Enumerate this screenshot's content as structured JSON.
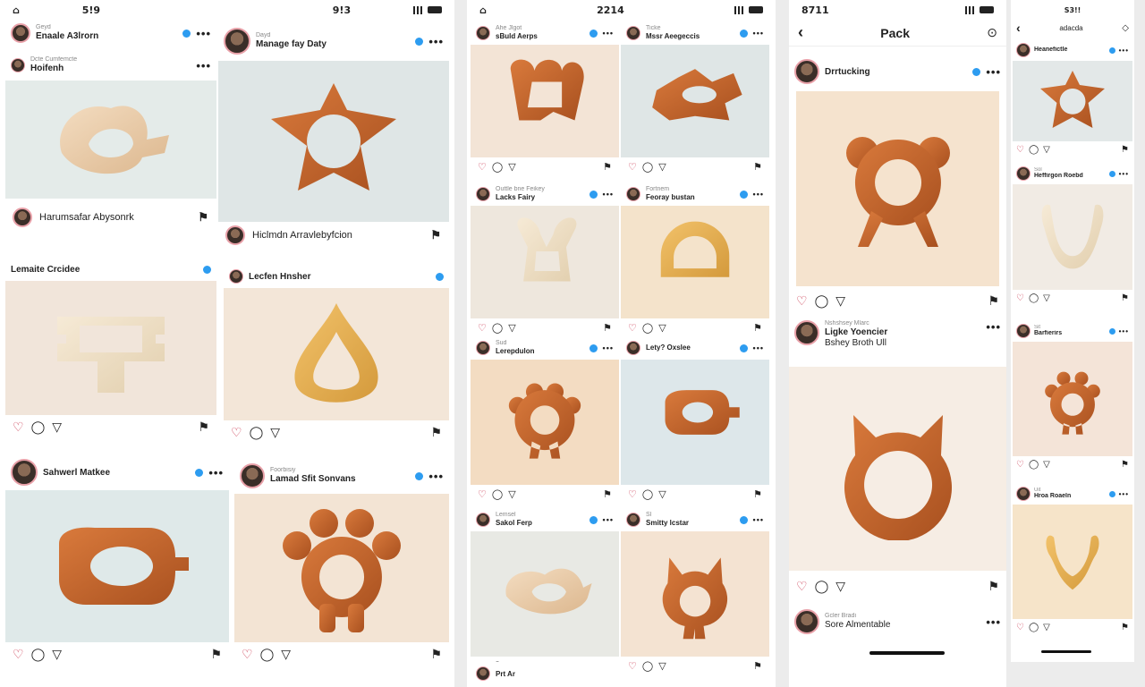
{
  "phone1": {
    "status": {
      "time_left": "5!9",
      "time_right": "9!3"
    },
    "posts": [
      {
        "user": "Enaale A3lrorn",
        "sub": "Geyd"
      },
      {
        "user": "Manage fay Daty",
        "sub": "Dayd"
      },
      {
        "user": "Hoifenh",
        "sub": "Dcte Cumfemcte"
      },
      {
        "caption": "Harumsafar Abysonrk"
      },
      {
        "caption": "Hiclmdn Arravlebyfcion"
      },
      {
        "user": "Lemaite Crcidee"
      },
      {
        "user": "Lecfen Hnsher"
      },
      {
        "user": "Sahwerl Matkee"
      },
      {
        "user": "Lamad Sfit Sonvans",
        "sub": "Foorbisiy"
      }
    ]
  },
  "phone2": {
    "status": {
      "time": "2214"
    },
    "posts": [
      {
        "user": "sBuld Aerps",
        "sub": "Ahe Jlgot"
      },
      {
        "user": "Mssr Aeegeccis",
        "sub": "Ticke"
      },
      {
        "user": "Lacks Fairy",
        "sub": "Outtle bne Feikey"
      },
      {
        "user": "Feoray bustan",
        "sub": "Fortnem"
      },
      {
        "user": "Lerepdulon",
        "sub": "Sud"
      },
      {
        "user": "Lety? Oxslee"
      },
      {
        "user": "Sakol Ferp",
        "sub": "Lemsel"
      },
      {
        "user": "Smitty lcstar",
        "sub": "Sl"
      },
      {
        "user": "Prt Ar"
      }
    ]
  },
  "phone3": {
    "status": {
      "time": "8711"
    },
    "title": "Pack",
    "posts": [
      {
        "user": "Drrtucking"
      },
      {
        "user": "Ligke Yoencier",
        "sub": "Nshshsey Mlarc",
        "sub2": "Bshey Broth Ull"
      },
      {
        "user": "Sore Almentable",
        "sub": "Gcler Bradi"
      }
    ]
  },
  "phone4": {
    "status": {
      "time": "S3!!",
      "title": "adacda"
    },
    "posts": [
      {
        "user": "Heanefictle"
      },
      {
        "user": "Heffirgon Roebd",
        "sub": "Sol"
      },
      {
        "user": "Barfierirs",
        "sub": "Sit"
      },
      {
        "user": "Hroa Roaeln",
        "sub": "Uit"
      }
    ]
  },
  "colors": {
    "heart": "#c8324a",
    "verified": "#2d9cf0",
    "wood_dark": "#b25a26",
    "wood_light": "#e9c49a"
  }
}
